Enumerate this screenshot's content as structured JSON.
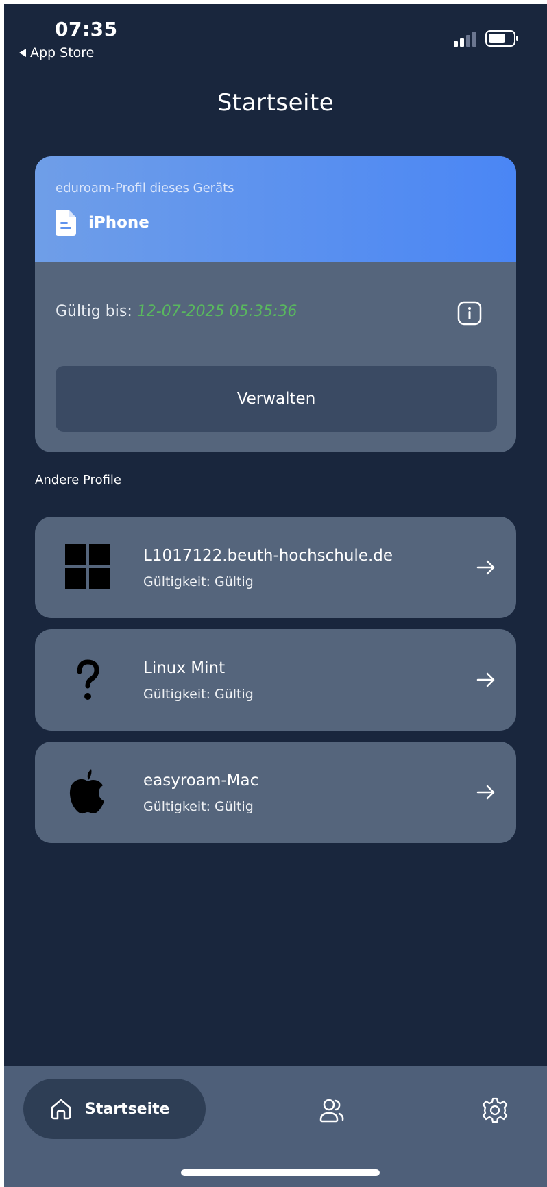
{
  "status_bar": {
    "time": "07:35",
    "back_label": "App Store"
  },
  "page": {
    "title": "Startseite"
  },
  "device_profile": {
    "caption": "eduroam-Profil dieses Geräts",
    "device_name": "iPhone",
    "valid_label": "Gültig bis:",
    "valid_until": "12-07-2025 05:35:36",
    "manage_label": "Verwalten"
  },
  "other_profiles": {
    "section_label": "Andere Profile",
    "items": [
      {
        "name": "L1017122.beuth-hochschule.de",
        "validity": "Gültigkeit: Gültig",
        "icon": "windows-icon"
      },
      {
        "name": "Linux Mint",
        "validity": "Gültigkeit: Gültig",
        "icon": "question-icon"
      },
      {
        "name": "easyroam-Mac",
        "validity": "Gültigkeit: Gültig",
        "icon": "apple-icon"
      }
    ]
  },
  "tab_bar": {
    "home_label": "Startseite"
  },
  "colors": {
    "background": "#19263d",
    "card": "#55657c",
    "accent": "#4a86f5",
    "valid_date": "#59b85e",
    "tab_bar": "#4e5f79"
  }
}
